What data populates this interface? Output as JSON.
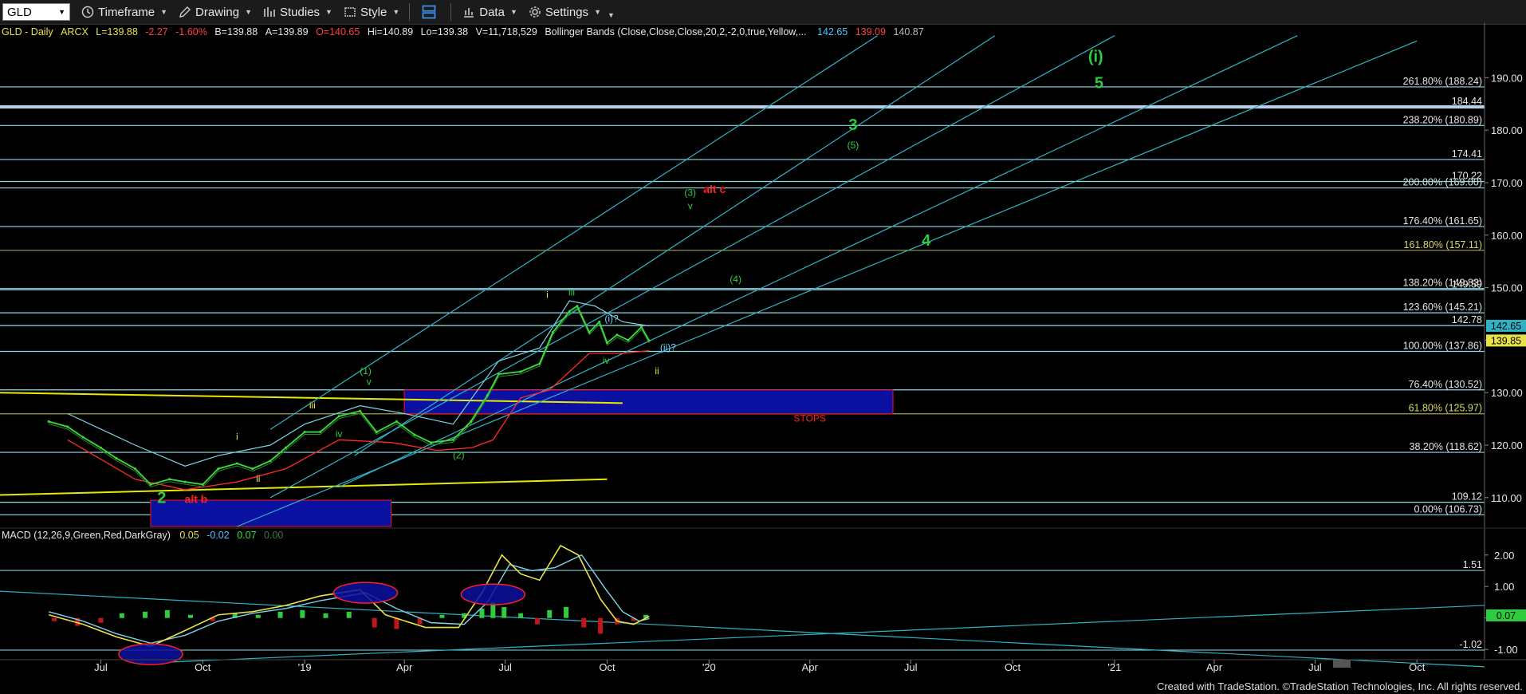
{
  "toolbar": {
    "symbol": "GLD",
    "timeframe": "Timeframe",
    "drawing": "Drawing",
    "studies": "Studies",
    "style": "Style",
    "data": "Data",
    "settings": "Settings"
  },
  "info": {
    "title": "GLD - Daily",
    "exchange": "ARCX",
    "last": "L=139.88",
    "change": "-2.27",
    "pct": "-1.60%",
    "bid": "B=139.88",
    "ask": "A=139.89",
    "open": "O=140.65",
    "high": "Hi=140.89",
    "low": "Lo=139.38",
    "volume": "V=11,718,529",
    "study": "Bollinger Bands (Close,Close,Close,20,2,-2,0,true,Yellow,...",
    "bb_upper": "142.65",
    "bb_mid": "139.09",
    "bb_lower": "140.87"
  },
  "macd": {
    "label": "MACD (12,26,9,Green,Red,DarkGray)",
    "v1": "0.05",
    "v2": "-0.02",
    "v3": "0.07",
    "v4": "0.00"
  },
  "footer": "Created with TradeStation. ©TradeStation Technologies, Inc. All rights reserved.",
  "colors": {
    "background": "#000000",
    "channel": "#2fb3c4",
    "bollinger": "#7fd3e6",
    "bb_lower": "#ff2a2a",
    "price": "#3ddc3d",
    "wave_green": "#2ecc40",
    "wave_yellow": "#e8e24a",
    "alt_red": "#ff2020",
    "zone_blue": "#0a10a0",
    "fib_line": "#8fdbe8",
    "trend_yellow": "#e8e800"
  },
  "chart_data": {
    "type": "line",
    "title": "GLD - Daily",
    "x_ticks": [
      "Jul",
      "Oct",
      "'19",
      "Apr",
      "Jul",
      "Oct",
      "'20",
      "Apr",
      "Jul",
      "Oct",
      "'21",
      "Apr",
      "Jul",
      "Oct"
    ],
    "y_ticks": [
      110.0,
      120.0,
      130.0,
      140.0,
      150.0,
      160.0,
      170.0,
      180.0,
      190.0
    ],
    "ylim": [
      104.5,
      197.5
    ],
    "fib_levels": [
      {
        "label": "261.80% (188.24)",
        "value": 188.24
      },
      {
        "label": "238.20% (180.89)",
        "value": 180.89
      },
      {
        "label": "200.00% (169.00)",
        "value": 169.0
      },
      {
        "label": "176.40% (161.65)",
        "value": 161.65
      },
      {
        "label": "161.80% (157.11)",
        "value": 157.11
      },
      {
        "label": "138.20% (149.83)",
        "value": 149.83
      },
      {
        "label": "123.60% (145.21)",
        "value": 145.21
      },
      {
        "label": "100.00% (137.86)",
        "value": 137.86
      },
      {
        "label": "76.40% (130.52)",
        "value": 130.52
      },
      {
        "label": "61.80% (125.97)",
        "value": 125.97
      },
      {
        "label": "38.20% (118.62)",
        "value": 118.62
      },
      {
        "label": "0.00% (106.73)",
        "value": 106.73
      }
    ],
    "price_levels": [
      {
        "label": "184.44",
        "value": 184.44
      },
      {
        "label": "174.41",
        "value": 174.41
      },
      {
        "label": "170.22",
        "value": 170.22
      },
      {
        "label": "149.59",
        "value": 149.59
      },
      {
        "label": "142.78",
        "value": 142.78
      },
      {
        "label": "109.12",
        "value": 109.12
      }
    ],
    "last_price_tags": [
      {
        "label": "142.65",
        "value": 142.65,
        "color": "#2fb3c4"
      },
      {
        "label": "139.85",
        "value": 139.85,
        "color": "#e8e24a"
      }
    ],
    "price_series": [
      [
        "2018-05-15",
        124.5
      ],
      [
        "2018-06-01",
        123.5
      ],
      [
        "2018-06-15",
        121.5
      ],
      [
        "2018-07-01",
        119.5
      ],
      [
        "2018-07-15",
        117.5
      ],
      [
        "2018-08-01",
        115.5
      ],
      [
        "2018-08-15",
        112.5
      ],
      [
        "2018-09-01",
        113.5
      ],
      [
        "2018-09-15",
        113.0
      ],
      [
        "2018-10-01",
        112.5
      ],
      [
        "2018-10-15",
        115.5
      ],
      [
        "2018-11-01",
        116.5
      ],
      [
        "2018-11-15",
        115.5
      ],
      [
        "2018-12-01",
        117.0
      ],
      [
        "2018-12-15",
        119.5
      ],
      [
        "2019-01-01",
        122.5
      ],
      [
        "2019-01-15",
        122.5
      ],
      [
        "2019-02-01",
        125.5
      ],
      [
        "2019-02-20",
        126.5
      ],
      [
        "2019-03-07",
        122.5
      ],
      [
        "2019-03-25",
        124.5
      ],
      [
        "2019-04-10",
        122.0
      ],
      [
        "2019-04-25",
        120.5
      ],
      [
        "2019-05-15",
        121.0
      ],
      [
        "2019-05-31",
        124.5
      ],
      [
        "2019-06-15",
        129.5
      ],
      [
        "2019-06-25",
        133.5
      ],
      [
        "2019-07-15",
        134.0
      ],
      [
        "2019-08-01",
        135.5
      ],
      [
        "2019-08-13",
        141.5
      ],
      [
        "2019-08-28",
        145.5
      ],
      [
        "2019-09-04",
        146.5
      ],
      [
        "2019-09-15",
        141.5
      ],
      [
        "2019-09-24",
        143.5
      ],
      [
        "2019-10-01",
        139.5
      ],
      [
        "2019-10-10",
        141.0
      ],
      [
        "2019-10-20",
        140.0
      ],
      [
        "2019-11-01",
        142.5
      ],
      [
        "2019-11-08",
        139.9
      ]
    ],
    "bb_upper_series": [
      [
        "2018-06-01",
        126.0
      ],
      [
        "2018-08-01",
        120.0
      ],
      [
        "2018-09-15",
        116.0
      ],
      [
        "2018-10-15",
        118.0
      ],
      [
        "2018-12-01",
        120.0
      ],
      [
        "2019-01-01",
        124.0
      ],
      [
        "2019-02-20",
        127.5
      ],
      [
        "2019-04-01",
        126.0
      ],
      [
        "2019-05-15",
        124.0
      ],
      [
        "2019-06-25",
        136.0
      ],
      [
        "2019-08-01",
        138.5
      ],
      [
        "2019-08-28",
        147.5
      ],
      [
        "2019-09-20",
        146.5
      ],
      [
        "2019-10-15",
        143.5
      ],
      [
        "2019-11-08",
        142.7
      ]
    ],
    "bb_lower_series": [
      [
        "2018-06-01",
        121.0
      ],
      [
        "2018-08-01",
        113.5
      ],
      [
        "2018-09-15",
        111.5
      ],
      [
        "2018-11-01",
        113.0
      ],
      [
        "2018-12-15",
        115.5
      ],
      [
        "2019-02-01",
        121.0
      ],
      [
        "2019-03-20",
        120.5
      ],
      [
        "2019-05-01",
        119.0
      ],
      [
        "2019-06-01",
        119.5
      ],
      [
        "2019-06-20",
        121.0
      ],
      [
        "2019-07-15",
        129.0
      ],
      [
        "2019-08-10",
        130.5
      ],
      [
        "2019-09-15",
        137.5
      ],
      [
        "2019-10-15",
        137.5
      ],
      [
        "2019-11-08",
        138.0
      ]
    ],
    "wave_labels": [
      {
        "text": "(i)",
        "date": "2020-12-15",
        "price": 193.0,
        "color": "green",
        "size": "big"
      },
      {
        "text": "5",
        "date": "2020-12-18",
        "price": 188.0,
        "color": "green",
        "size": "big"
      },
      {
        "text": "3",
        "date": "2020-05-10",
        "price": 180.0,
        "color": "green",
        "size": "big"
      },
      {
        "text": "(5)",
        "date": "2020-05-10",
        "price": 176.5,
        "color": "green",
        "size": "small"
      },
      {
        "text": "(3)",
        "date": "2019-12-15",
        "price": 167.5,
        "color": "green",
        "size": "small"
      },
      {
        "text": "v",
        "date": "2019-12-15",
        "price": 165.0,
        "color": "green",
        "size": "small"
      },
      {
        "text": "alt c",
        "date": "2020-01-06",
        "price": 168.0,
        "color": "red",
        "size": "mid"
      },
      {
        "text": "4",
        "date": "2020-07-15",
        "price": 158.0,
        "color": "green",
        "size": "big"
      },
      {
        "text": "(4)",
        "date": "2020-01-25",
        "price": 151.0,
        "color": "green",
        "size": "small"
      },
      {
        "text": "i",
        "date": "2019-08-08",
        "price": 148.0,
        "color": "yellow",
        "size": "small"
      },
      {
        "text": "iii",
        "date": "2019-08-30",
        "price": 148.5,
        "color": "green",
        "size": "small"
      },
      {
        "text": "(i)?",
        "date": "2019-10-05",
        "price": 143.5,
        "color": "cyan",
        "size": "small"
      },
      {
        "text": "(ii)?",
        "date": "2019-11-25",
        "price": 138.0,
        "color": "cyan",
        "size": "small"
      },
      {
        "text": "iv",
        "date": "2019-09-30",
        "price": 135.5,
        "color": "green",
        "size": "small"
      },
      {
        "text": "ii",
        "date": "2019-11-15",
        "price": 133.5,
        "color": "yellow",
        "size": "small"
      },
      {
        "text": "(1)",
        "date": "2019-02-25",
        "price": 133.5,
        "color": "green",
        "size": "small"
      },
      {
        "text": "v",
        "date": "2019-02-28",
        "price": 131.5,
        "color": "green",
        "size": "small"
      },
      {
        "text": "iii",
        "date": "2019-01-08",
        "price": 127.0,
        "color": "yellow",
        "size": "small"
      },
      {
        "text": "iv",
        "date": "2019-02-01",
        "price": 121.5,
        "color": "green",
        "size": "small"
      },
      {
        "text": "i",
        "date": "2018-11-01",
        "price": 121.0,
        "color": "yellow",
        "size": "small"
      },
      {
        "text": "ii",
        "date": "2018-11-20",
        "price": 113.0,
        "color": "yellow",
        "size": "small"
      },
      {
        "text": "(2)",
        "date": "2019-05-20",
        "price": 117.5,
        "color": "green",
        "size": "small"
      },
      {
        "text": "2",
        "date": "2018-08-25",
        "price": 109.0,
        "color": "green",
        "size": "big"
      },
      {
        "text": "alt b",
        "date": "2018-09-25",
        "price": 109.0,
        "color": "red",
        "size": "mid"
      },
      {
        "text": "STOPS",
        "date": "2020-04-01",
        "price": 124.5,
        "color": "red",
        "size": "small"
      }
    ],
    "zones": [
      {
        "from": "2019-04-01",
        "to": "2020-06-15",
        "low": 126.0,
        "high": 130.5
      },
      {
        "from": "2018-08-15",
        "to": "2019-03-20",
        "low": 104.5,
        "high": 109.5
      }
    ],
    "channel_lines": [
      {
        "from": [
          "2018-12-01",
          123.0
        ],
        "to": [
          "2020-06-01",
          198.0
        ]
      },
      {
        "from": [
          "2019-02-15",
          118.0
        ],
        "to": [
          "2020-09-15",
          198.0
        ]
      },
      {
        "from": [
          "2018-12-01",
          110.0
        ],
        "to": [
          "2021-01-01",
          198.0
        ]
      },
      {
        "from": [
          "2019-02-01",
          112.0
        ],
        "to": [
          "2021-06-15",
          198.0
        ]
      },
      {
        "from": [
          "2018-11-01",
          104.5
        ],
        "to": [
          "2021-10-01",
          197.0
        ]
      }
    ],
    "trend_lines": [
      {
        "from": [
          "2018-04-01",
          130.0
        ],
        "to": [
          "2019-10-15",
          128.0
        ]
      },
      {
        "from": [
          "2018-04-01",
          110.5
        ],
        "to": [
          "2019-10-01",
          113.5
        ]
      }
    ],
    "macd_ticks": [
      2.0,
      1.0,
      0.0,
      -1.0
    ],
    "macd_level_labels": [
      "1.51",
      "-1.02"
    ],
    "macd_levels": [
      1.51,
      -1.02
    ],
    "macd_current_label": "0.07",
    "macd_ylim": [
      -1.35,
      2.45
    ],
    "macd_line": [
      [
        "2018-05-15",
        0.1
      ],
      [
        "2018-06-15",
        -0.2
      ],
      [
        "2018-07-15",
        -0.6
      ],
      [
        "2018-08-15",
        -0.9
      ],
      [
        "2018-09-15",
        -0.4
      ],
      [
        "2018-10-15",
        0.1
      ],
      [
        "2018-11-15",
        0.2
      ],
      [
        "2018-12-15",
        0.4
      ],
      [
        "2019-01-15",
        0.7
      ],
      [
        "2019-02-20",
        0.9
      ],
      [
        "2019-03-15",
        0.1
      ],
      [
        "2019-04-20",
        -0.3
      ],
      [
        "2019-05-20",
        -0.3
      ],
      [
        "2019-06-10",
        0.8
      ],
      [
        "2019-06-28",
        2.0
      ],
      [
        "2019-07-15",
        1.4
      ],
      [
        "2019-08-01",
        1.2
      ],
      [
        "2019-08-20",
        2.3
      ],
      [
        "2019-09-05",
        2.0
      ],
      [
        "2019-09-25",
        0.6
      ],
      [
        "2019-10-10",
        -0.1
      ],
      [
        "2019-10-25",
        -0.2
      ],
      [
        "2019-11-08",
        0.05
      ]
    ],
    "signal_line": [
      [
        "2018-05-15",
        0.2
      ],
      [
        "2018-06-15",
        -0.1
      ],
      [
        "2018-07-15",
        -0.5
      ],
      [
        "2018-08-15",
        -0.8
      ],
      [
        "2018-09-15",
        -0.55
      ],
      [
        "2018-10-15",
        -0.1
      ],
      [
        "2018-11-15",
        0.15
      ],
      [
        "2018-12-15",
        0.3
      ],
      [
        "2019-01-15",
        0.55
      ],
      [
        "2019-02-25",
        0.8
      ],
      [
        "2019-03-25",
        0.3
      ],
      [
        "2019-04-25",
        -0.15
      ],
      [
        "2019-05-25",
        -0.2
      ],
      [
        "2019-06-15",
        0.5
      ],
      [
        "2019-07-05",
        1.7
      ],
      [
        "2019-07-25",
        1.5
      ],
      [
        "2019-08-15",
        1.6
      ],
      [
        "2019-09-08",
        2.0
      ],
      [
        "2019-09-30",
        0.9
      ],
      [
        "2019-10-15",
        0.2
      ],
      [
        "2019-10-30",
        -0.1
      ],
      [
        "2019-11-08",
        -0.02
      ]
    ],
    "histogram": [
      [
        "2018-05-20",
        -0.1
      ],
      [
        "2018-06-10",
        -0.25
      ],
      [
        "2018-07-01",
        -0.15
      ],
      [
        "2018-07-20",
        0.15
      ],
      [
        "2018-08-10",
        0.2
      ],
      [
        "2018-08-30",
        0.25
      ],
      [
        "2018-09-20",
        0.1
      ],
      [
        "2018-10-10",
        -0.1
      ],
      [
        "2018-10-30",
        0.15
      ],
      [
        "2018-11-20",
        0.1
      ],
      [
        "2018-12-10",
        0.2
      ],
      [
        "2018-12-30",
        0.25
      ],
      [
        "2019-01-20",
        0.15
      ],
      [
        "2019-02-10",
        0.2
      ],
      [
        "2019-03-05",
        -0.3
      ],
      [
        "2019-03-25",
        -0.35
      ],
      [
        "2019-04-15",
        -0.2
      ],
      [
        "2019-05-05",
        0.1
      ],
      [
        "2019-05-25",
        0.15
      ],
      [
        "2019-06-10",
        0.3
      ],
      [
        "2019-06-20",
        0.5
      ],
      [
        "2019-06-30",
        0.35
      ],
      [
        "2019-07-15",
        0.15
      ],
      [
        "2019-07-30",
        -0.2
      ],
      [
        "2019-08-10",
        0.25
      ],
      [
        "2019-08-25",
        0.35
      ],
      [
        "2019-09-10",
        -0.3
      ],
      [
        "2019-09-25",
        -0.5
      ],
      [
        "2019-10-10",
        -0.2
      ],
      [
        "2019-10-25",
        -0.1
      ],
      [
        "2019-11-05",
        0.1
      ]
    ],
    "macd_trend_lines": [
      {
        "from": [
          "2018-04-01",
          0.85
        ],
        "to": [
          "2021-12-01",
          -1.55
        ]
      },
      {
        "from": [
          "2018-09-01",
          -1.4
        ],
        "to": [
          "2021-12-01",
          0.4
        ]
      }
    ],
    "ellipses": [
      {
        "date": "2019-02-25",
        "value": 0.8,
        "color": "red"
      },
      {
        "date": "2019-06-20",
        "value": 0.75,
        "color": "red"
      },
      {
        "date": "2018-08-15",
        "value": -1.15,
        "color": "red"
      }
    ]
  }
}
